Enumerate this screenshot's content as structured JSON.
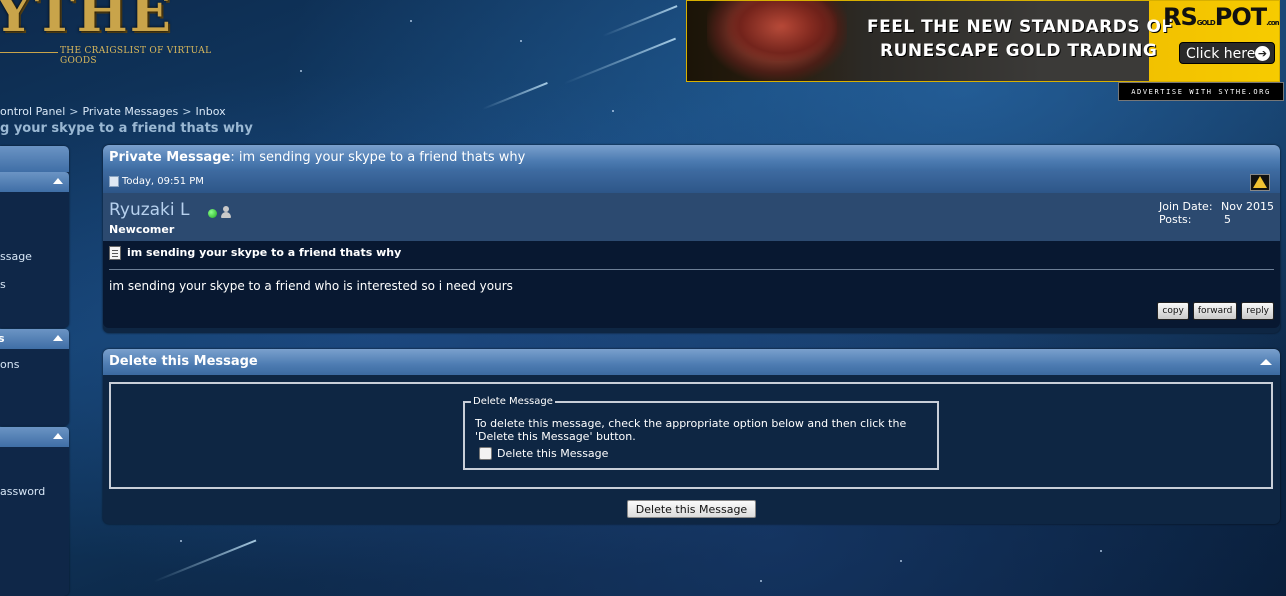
{
  "logo": {
    "text": "YTHE",
    "tagline": "THE CRAIGSLIST OF VIRTUAL GOODS"
  },
  "ad": {
    "headline_1": "FEEL THE NEW STANDARDS OF",
    "headline_2": "RUNESCAPE GOLD TRADING",
    "brand": "RS",
    "brand_gold": "GOLD",
    "brand_tail": "POT",
    "brand_suffix": ".com",
    "cta": "Click here",
    "advertise": "ADVERTISE WITH SYTHE.ORG"
  },
  "breadcrumb": [
    {
      "label": "ontrol Panel"
    },
    {
      "label": "Private Messages"
    },
    {
      "label": "Inbox"
    }
  ],
  "breadcrumb_sep": ">",
  "page_title": "g your skype to a friend thats why",
  "sidebar": {
    "block1_items": [
      "ssage",
      "s"
    ],
    "block2_head": "s",
    "block2_items": [
      "ons"
    ],
    "block3_items": [
      "assword"
    ]
  },
  "message": {
    "panel_label": "Private Message",
    "panel_title": ": im sending your skype to a friend thats why",
    "date": "Today, 09:51 PM",
    "username": "Ryuzaki L",
    "user_title": "Newcomer",
    "join_label": "Join Date:",
    "join_value": "Nov 2015",
    "posts_label": "Posts:",
    "posts_value": "5",
    "title": "im sending your skype to a friend thats why",
    "body": "im sending your skype to a friend who is interested so i need yours",
    "actions": {
      "copy": "copy",
      "forward": "forward",
      "reply": "reply"
    }
  },
  "delete_panel": {
    "title": "Delete this Message",
    "legend": "Delete Message",
    "instructions": "To delete this message, check the appropriate option below and then click the 'Delete this Message' button.",
    "checkbox_label": "Delete this Message",
    "checkbox_checked": false,
    "button": "Delete this Message"
  },
  "colors": {
    "accent": "#4d7cb2",
    "panel_bg": "#0e2643",
    "ad_yellow": "#f6cb00"
  }
}
